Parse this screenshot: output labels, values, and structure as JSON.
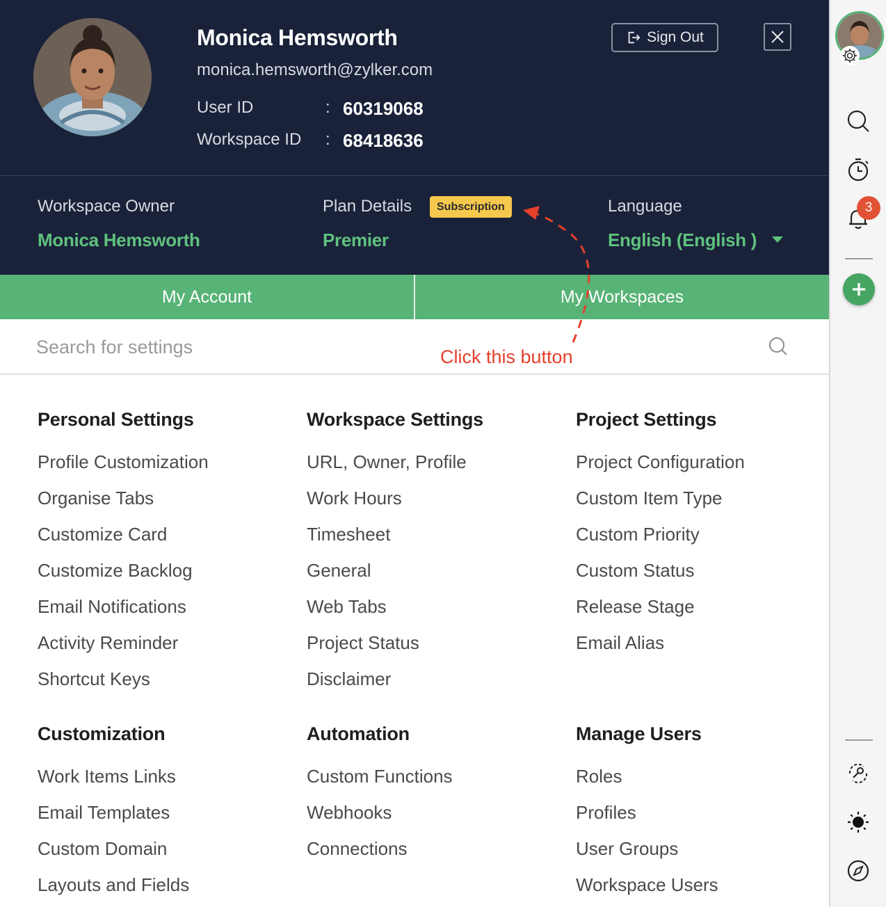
{
  "profile": {
    "name": "Monica Hemsworth",
    "email": "monica.hemsworth@zylker.com",
    "user_id_label": "User ID",
    "user_id": "60319068",
    "workspace_id_label": "Workspace ID",
    "workspace_id": "68418636",
    "colon": ":"
  },
  "header": {
    "sign_out_label": "Sign Out",
    "close_icon": "close-icon"
  },
  "workspace_info": {
    "owner_label": "Workspace Owner",
    "owner_value": "Monica Hemsworth",
    "plan_label": "Plan Details",
    "plan_badge": "Subscription",
    "plan_value": "Premier",
    "language_label": "Language",
    "language_value": "English (English )"
  },
  "tabs": [
    "My Account",
    "My Workspaces"
  ],
  "search": {
    "placeholder": "Search for settings"
  },
  "annotation": {
    "text": "Click this button",
    "color": "#e4402b"
  },
  "sections": [
    {
      "title": "Personal Settings",
      "items": [
        "Profile Customization",
        "Organise Tabs",
        "Customize Card",
        "Customize Backlog",
        "Email Notifications",
        "Activity Reminder",
        "Shortcut Keys"
      ]
    },
    {
      "title": "Workspace Settings",
      "items": [
        "URL, Owner, Profile",
        "Work Hours",
        "Timesheet",
        "General",
        "Web Tabs",
        "Project Status",
        "Disclaimer"
      ]
    },
    {
      "title": "Project Settings",
      "items": [
        "Project Configuration",
        "Custom Item Type",
        "Custom Priority",
        "Custom Status",
        "Release Stage",
        "Email Alias"
      ]
    },
    {
      "title": "Customization",
      "items": [
        "Work Items Links",
        "Email Templates",
        "Custom Domain",
        "Layouts and Fields"
      ]
    },
    {
      "title": "Automation",
      "items": [
        "Custom Functions",
        "Webhooks",
        "Connections"
      ]
    },
    {
      "title": "Manage Users",
      "items": [
        "Roles",
        "Profiles",
        "User Groups",
        "Workspace Users"
      ]
    }
  ],
  "rail": {
    "notification_count": "3",
    "icons": [
      "search-icon",
      "timer-icon",
      "bell-icon",
      "add-icon",
      "integrations-icon",
      "theme-icon",
      "compass-icon"
    ]
  },
  "colors": {
    "header_bg": "#192239",
    "accent_green": "#58b377",
    "value_green": "#5fc27e",
    "badge_yellow": "#f6c94e",
    "notification_red": "#e15234"
  }
}
